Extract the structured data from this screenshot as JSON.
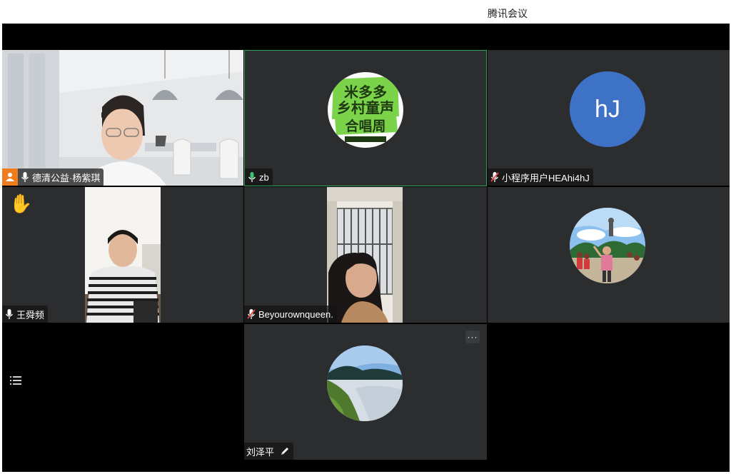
{
  "window": {
    "title": "腾讯会议"
  },
  "participants": [
    {
      "name": "德清公益·杨紫琪",
      "mic": "on",
      "host": true
    },
    {
      "name": "zb",
      "mic": "on",
      "speaking": true
    },
    {
      "name": "小程序用户HEAhi4hJ",
      "mic": "muted",
      "avatar_text": "hJ",
      "avatar_color": "#3e72c6"
    },
    {
      "name": "王舜频",
      "mic": "on",
      "hand_raised": true,
      "hand_glyph": "✋"
    },
    {
      "name": "Beyourownqueen.",
      "mic": "muted"
    },
    {
      "name": "刘泽平",
      "mic": "none",
      "renamed": true,
      "more_glyph": "···"
    }
  ],
  "colors": {
    "accent": "#2ea35a",
    "host": "#f07d1d",
    "tile": "#2c2d2f",
    "stage": "#000000"
  },
  "icons": [
    "microphone-icon",
    "mic-muted-icon",
    "host-icon",
    "raise-hand-icon",
    "more-icon",
    "pencil-icon",
    "list-icon"
  ]
}
